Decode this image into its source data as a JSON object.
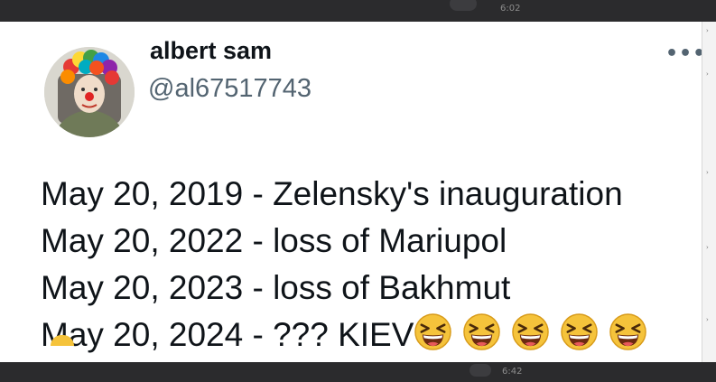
{
  "background": {
    "time_top": "6:02",
    "time_bottom": "6:42",
    "color": "#2b2b2d"
  },
  "tweet": {
    "display_name": "albert sam",
    "handle": "@al67517743",
    "more_icon": "more-dots-icon",
    "lines": [
      "May 20, 2019 - Zelensky's inauguration",
      "May 20, 2022 - loss of Mariupol",
      "May 20, 2023 - loss of Bakhmut",
      "May 20, 2024 - ???   KIEV"
    ],
    "emoji_name": "laughing-squinting-face-icon",
    "emoji_count": 5
  },
  "colors": {
    "name_text": "#0f1419",
    "handle_text": "#536471",
    "emoji_face": "#f5c33b"
  }
}
